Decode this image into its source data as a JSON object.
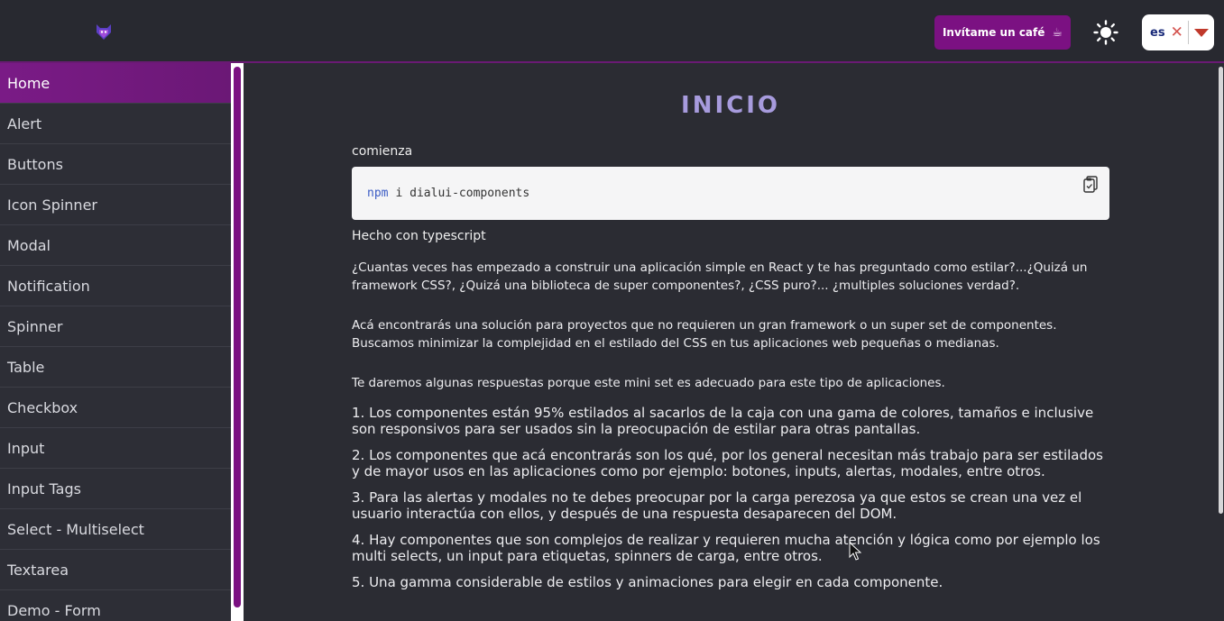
{
  "header": {
    "logo_icon": "fox-logo-icon",
    "coffee_label": "Invítame un café",
    "coffee_icon": "coffee-cup-icon",
    "theme_icon": "sun-icon",
    "language": {
      "selected": "es",
      "clear_icon": "close-icon",
      "caret_icon": "chevron-down-icon"
    }
  },
  "sidebar": {
    "items": [
      {
        "label": "Home"
      },
      {
        "label": "Alert"
      },
      {
        "label": "Buttons"
      },
      {
        "label": "Icon Spinner"
      },
      {
        "label": "Modal"
      },
      {
        "label": "Notification"
      },
      {
        "label": "Spinner"
      },
      {
        "label": "Table"
      },
      {
        "label": "Checkbox"
      },
      {
        "label": "Input"
      },
      {
        "label": "Input Tags"
      },
      {
        "label": "Select - Multiselect"
      },
      {
        "label": "Textarea"
      },
      {
        "label": "Demo - Form"
      }
    ],
    "active_index": 0
  },
  "main": {
    "title": "INICIO",
    "start_label": "comienza",
    "code": {
      "keyword": "npm",
      "rest": "i dialui-components",
      "copy_icon": "clipboard-icon"
    },
    "made_with": "Hecho con typescript",
    "intro1": "¿Cuantas veces has empezado a construir una aplicación simple en React y te has preguntado como estilar?...¿Quizá un framework CSS?, ¿Quizá una biblioteca de super componentes?, ¿CSS puro?... ¿multiples soluciones verdad?.",
    "intro2": "Acá encontrarás una solución para proyectos que no requieren un gran framework o un super set de componentes. Buscamos minimizar la complejidad en el estilado del CSS en tus aplicaciones web pequeñas o medianas.",
    "intro3": "Te daremos algunas respuestas porque este mini set es adecuado para este tipo de aplicaciones.",
    "points": [
      "1. Los componentes están 95% estilados al sacarlos de la caja con una gama de colores, tamaños e inclusive son responsivos para ser usados sin la preocupación de estilar para otras pantallas.",
      "2. Los componentes que acá encontrarás son los qué, por los general necesitan más trabajo para ser estilados y de mayor usos en las aplicaciones como por ejemplo: botones, inputs, alertas, modales, entre otros.",
      "3. Para las alertas y modales no te debes preocupar por la carga perezosa ya que estos se crean una vez el usuario interactúa con ellos, y después de una respuesta desaparecen del DOM.",
      "4. Hay componentes que son complejos de realizar y requieren mucha atención y lógica como por ejemplo los multi selects, un input para etiquetas, spinners de carga, entre otros.",
      "5. Una gamma considerable de estilos y animaciones para elegir en cada componente."
    ]
  },
  "colors": {
    "accent": "#7b1182",
    "title": "#a79bdd",
    "background": "#2b2c33"
  }
}
